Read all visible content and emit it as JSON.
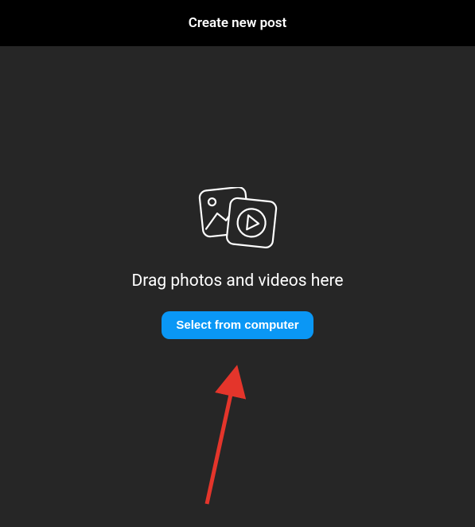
{
  "header": {
    "title": "Create new post"
  },
  "upload": {
    "prompt_text": "Drag photos and videos here",
    "button_label": "Select from computer"
  },
  "annotation": {
    "arrow_color": "#e4352b"
  },
  "icons": {
    "media_icon": "photo-video-icon"
  }
}
